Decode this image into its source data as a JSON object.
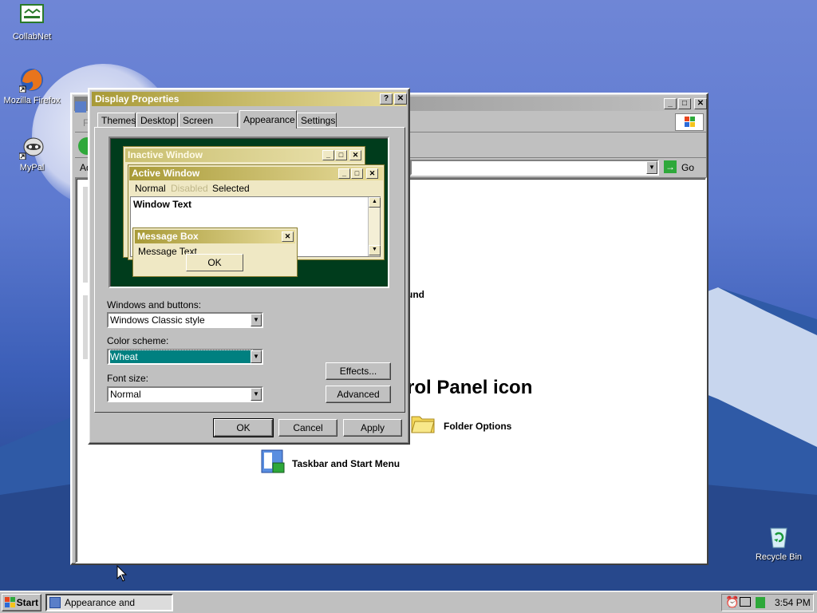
{
  "desktop": {
    "icons": [
      {
        "label": "CollabNet",
        "icon": "collabnet-icon"
      },
      {
        "label": "Mozilla Firefox",
        "icon": "firefox-icon"
      },
      {
        "label": "MyPal",
        "icon": "mypal-icon"
      },
      {
        "label": "Recycle Bin",
        "icon": "recycle-bin-icon"
      }
    ]
  },
  "explorer": {
    "menu_first_letter": "F",
    "address_label": "Ad",
    "go_label": "Go",
    "content": {
      "heading_fragment": "rol Panel icon",
      "sound_fragment": "und",
      "items": [
        "Folder Options",
        "Taskbar and Start Menu"
      ]
    }
  },
  "dialog": {
    "title": "Display Properties",
    "tabs": [
      "Themes",
      "Desktop",
      "Screen Saver",
      "Appearance",
      "Settings"
    ],
    "selected_tab": "Appearance",
    "preview": {
      "inactive_title": "Inactive Window",
      "active_title": "Active Window",
      "menu_normal": "Normal",
      "menu_disabled": "Disabled",
      "menu_selected": "Selected",
      "window_text": "Window Text",
      "msgbox_title": "Message Box",
      "msgbox_text": "Message Text",
      "msgbox_ok": "OK"
    },
    "windows_buttons_label": "Windows and buttons:",
    "windows_buttons_value": "Windows Classic style",
    "color_scheme_label": "Color scheme:",
    "color_scheme_value": "Wheat",
    "font_size_label": "Font size:",
    "font_size_value": "Normal",
    "effects_button": "Effects...",
    "advanced_button": "Advanced",
    "ok_button": "OK",
    "cancel_button": "Cancel",
    "apply_button": "Apply"
  },
  "taskbar": {
    "start_label": "Start",
    "task_label": "Appearance and Themes",
    "clock": "3:54 PM"
  },
  "colors": {
    "wheat_active": "#a89a37",
    "preview_bg": "#003c1c",
    "selection": "#008080"
  }
}
